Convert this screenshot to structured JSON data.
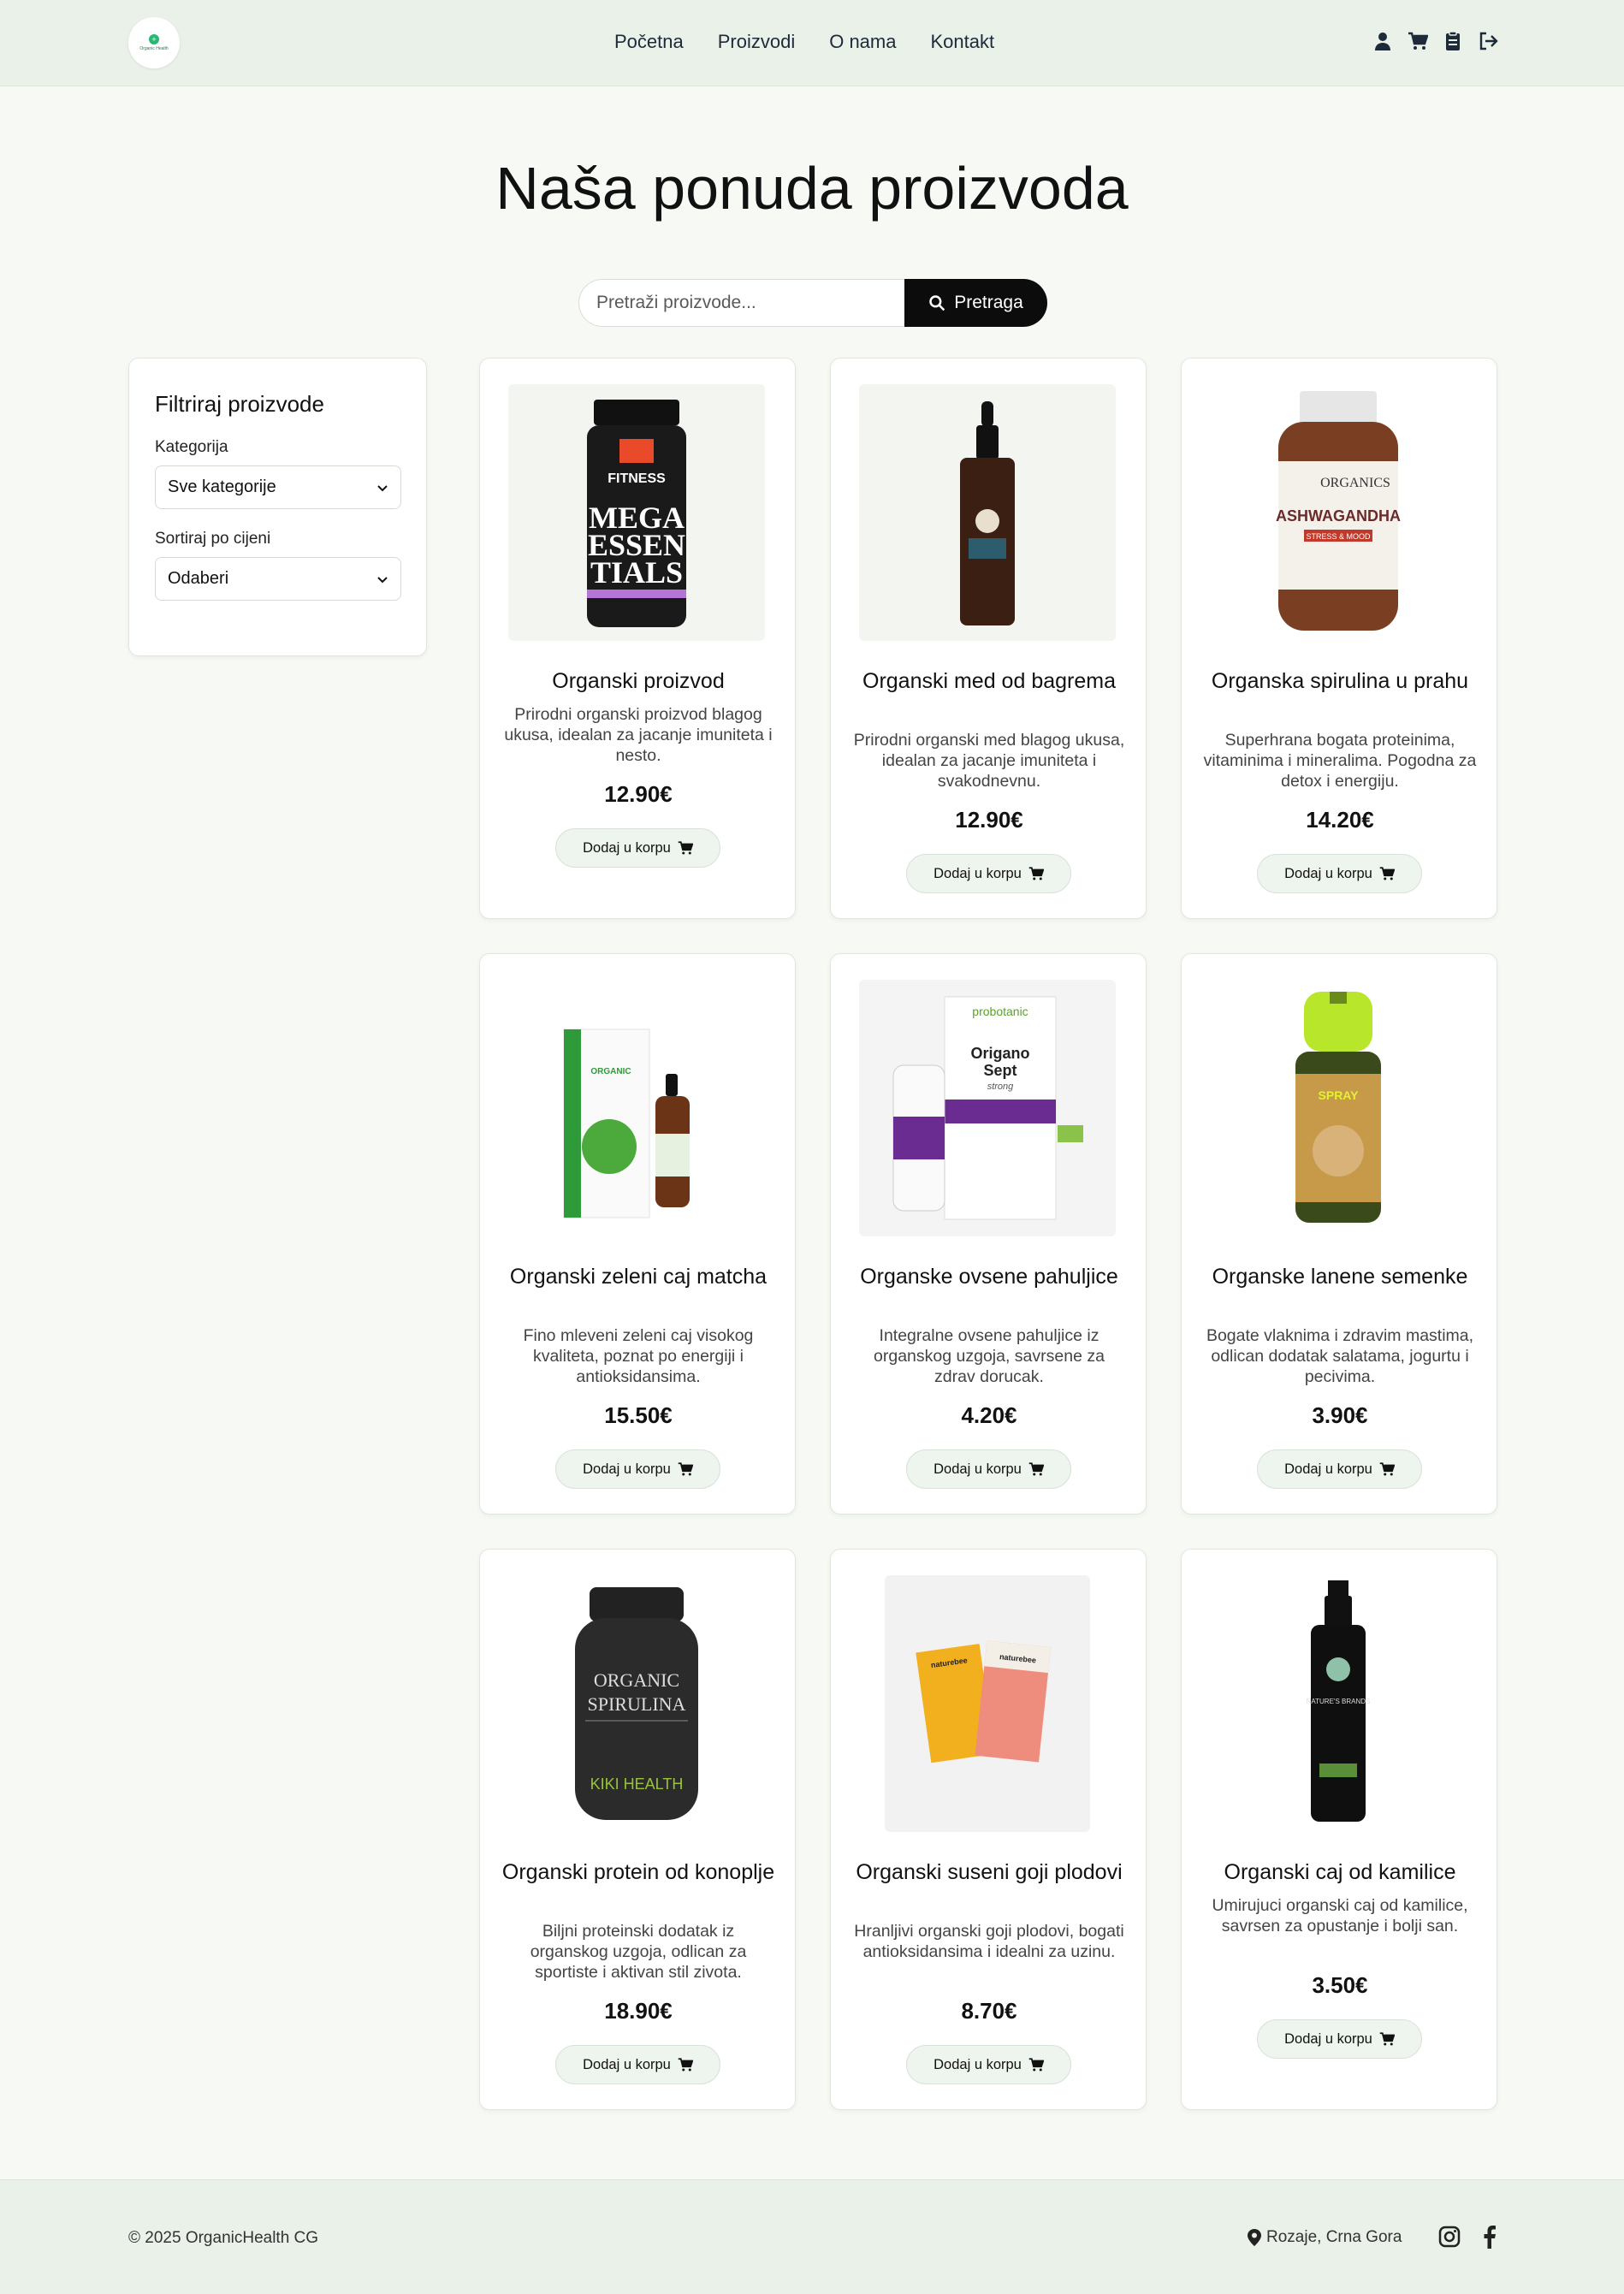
{
  "header": {
    "logo_text": "Organic Health",
    "nav": [
      "Početna",
      "Proizvodi",
      "O nama",
      "Kontakt"
    ],
    "icons": [
      "user-icon",
      "cart-icon",
      "clipboard-icon",
      "logout-icon"
    ]
  },
  "page_title": "Naša ponuda proizvoda",
  "search": {
    "placeholder": "Pretraži proizvode...",
    "button_label": "Pretraga"
  },
  "filter": {
    "title": "Filtriraj proizvode",
    "category_label": "Kategorija",
    "category_value": "Sve kategorije",
    "sort_label": "Sortiraj po cijeni",
    "sort_value": "Odaberi"
  },
  "add_to_cart_label": "Dodaj u korpu",
  "products": [
    {
      "name": "Organski proizvod",
      "desc": "Prirodni organski proizvod blagog ukusa, idealan za jacanje imuniteta i nesto.",
      "price": "12.90€"
    },
    {
      "name": "Organski med od bagrema",
      "desc": "Prirodni organski med blagog ukusa, idealan za jacanje imuniteta i svakodnevnu.",
      "price": "12.90€"
    },
    {
      "name": "Organska spirulina u prahu",
      "desc": "Superhrana bogata proteinima, vitaminima i mineralima. Pogodna za detox i energiju.",
      "price": "14.20€"
    },
    {
      "name": "Organski zeleni caj matcha",
      "desc": "Fino mleveni zeleni caj visokog kvaliteta, poznat po energiji i antioksidansima.",
      "price": "15.50€"
    },
    {
      "name": "Organske ovsene pahuljice",
      "desc": "Integralne ovsene pahuljice iz organskog uzgoja, savrsene za zdrav dorucak.",
      "price": "4.20€"
    },
    {
      "name": "Organske lanene semenke",
      "desc": "Bogate vlaknima i zdravim mastima, odlican dodatak salatama, jogurtu i pecivima.",
      "price": "3.90€"
    },
    {
      "name": "Organski protein od konoplje",
      "desc": "Biljni proteinski dodatak iz organskog uzgoja, odlican za sportiste i aktivan stil zivota.",
      "price": "18.90€"
    },
    {
      "name": "Organski suseni goji plodovi",
      "desc": "Hranljivi organski goji plodovi, bogati antioksidansima i idealni za uzinu.",
      "price": "8.70€"
    },
    {
      "name": "Organski caj od kamilice",
      "desc": "Umirujuci organski caj od kamilice, savrsen za opustanje i bolji san.",
      "price": "3.50€"
    }
  ],
  "product_labels": {
    "p1_brand": "FITNESS",
    "p1_line1": "MEGA",
    "p1_line2": "ESSEN",
    "p1_line3": "TIALS",
    "p3_brand": "ORGANICS",
    "p3_name": "ASHWAGANDHA",
    "p3_sub": "STRESS & MOOD",
    "p4_tag": "ORGANIC",
    "p5_brand": "probotanic",
    "p5_name": "Origano",
    "p5_name2": "Sept",
    "p5_sub": "strong",
    "p6_tag": "SPRAY",
    "p7_line1": "ORGANIC",
    "p7_line2": "SPIRULINA",
    "p7_brand": "KIKI HEALTH",
    "p8_brand": "naturebee",
    "p9_brand": "NATURE'S BRANDS"
  },
  "footer": {
    "copyright": "© 2025 OrganicHealth CG",
    "location": "Rozaje, Crna Gora",
    "social": [
      "instagram-icon",
      "facebook-icon"
    ]
  },
  "colors": {
    "page_bg": "#f7faf4",
    "header_bg": "#e9f1e8",
    "button_dark": "#0c0c0c",
    "cart_button_bg": "#eef4ee",
    "accent_green": "#2bb673"
  }
}
